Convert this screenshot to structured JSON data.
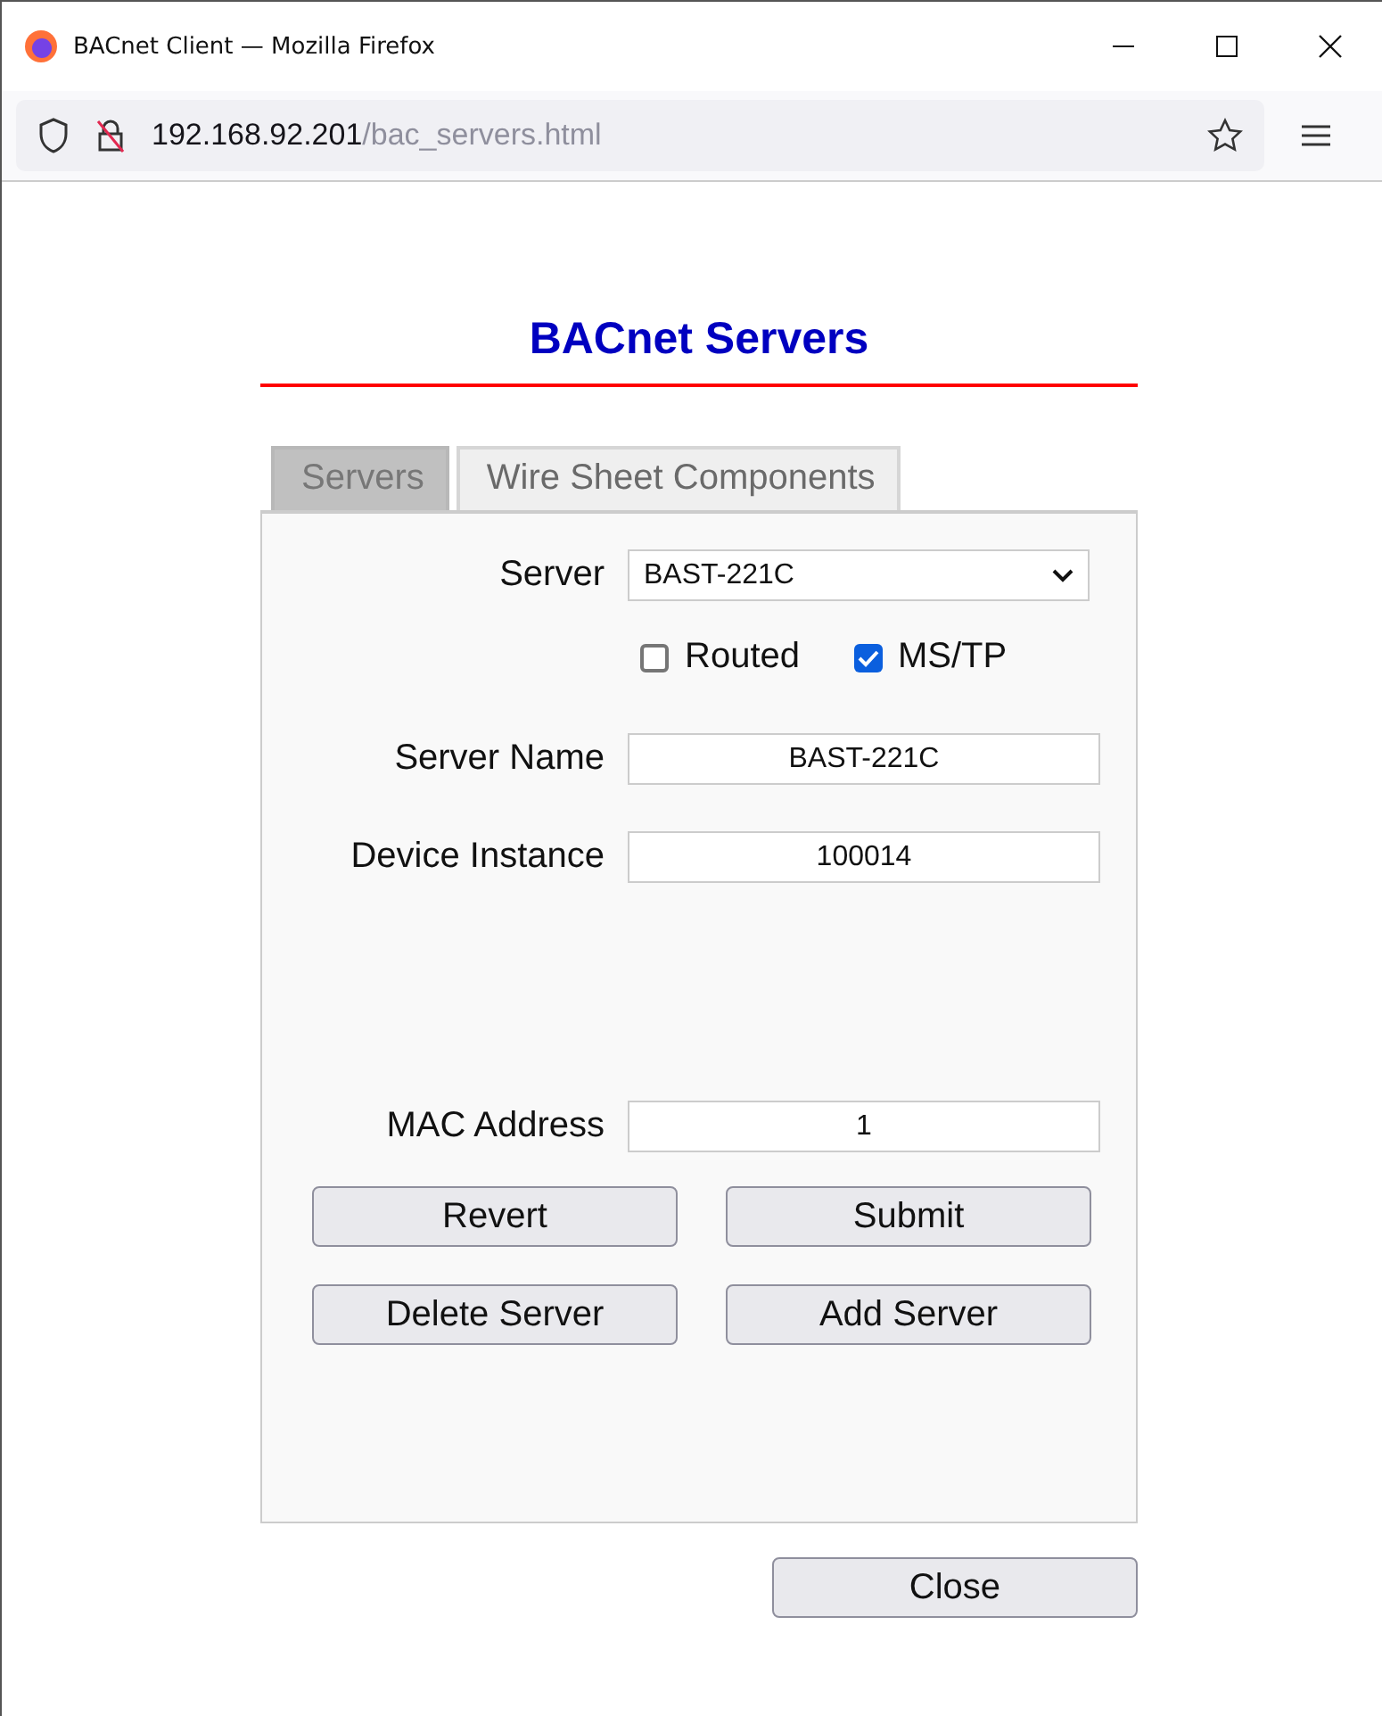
{
  "window": {
    "title": "BACnet Client — Mozilla Firefox"
  },
  "address_bar": {
    "host": "192.168.92.201",
    "path": "/bac_servers.html"
  },
  "page": {
    "heading": "BACnet Servers",
    "tabs": [
      {
        "label": "Servers",
        "selected": true
      },
      {
        "label": "Wire Sheet Components",
        "selected": false
      }
    ],
    "server_select": {
      "label": "Server",
      "value": "BAST-221C"
    },
    "checkboxes": [
      {
        "label": "Routed",
        "checked": false
      },
      {
        "label": "MS/TP",
        "checked": true
      }
    ],
    "fields": [
      {
        "label": "Server Name",
        "value": "BAST-221C"
      },
      {
        "label": "Device Instance",
        "value": "100014"
      },
      {
        "label": "MAC Address",
        "value": "1"
      }
    ],
    "buttons": [
      [
        "Revert",
        "Submit"
      ],
      [
        "Delete Server",
        "Add Server"
      ]
    ],
    "close_button": "Close"
  }
}
